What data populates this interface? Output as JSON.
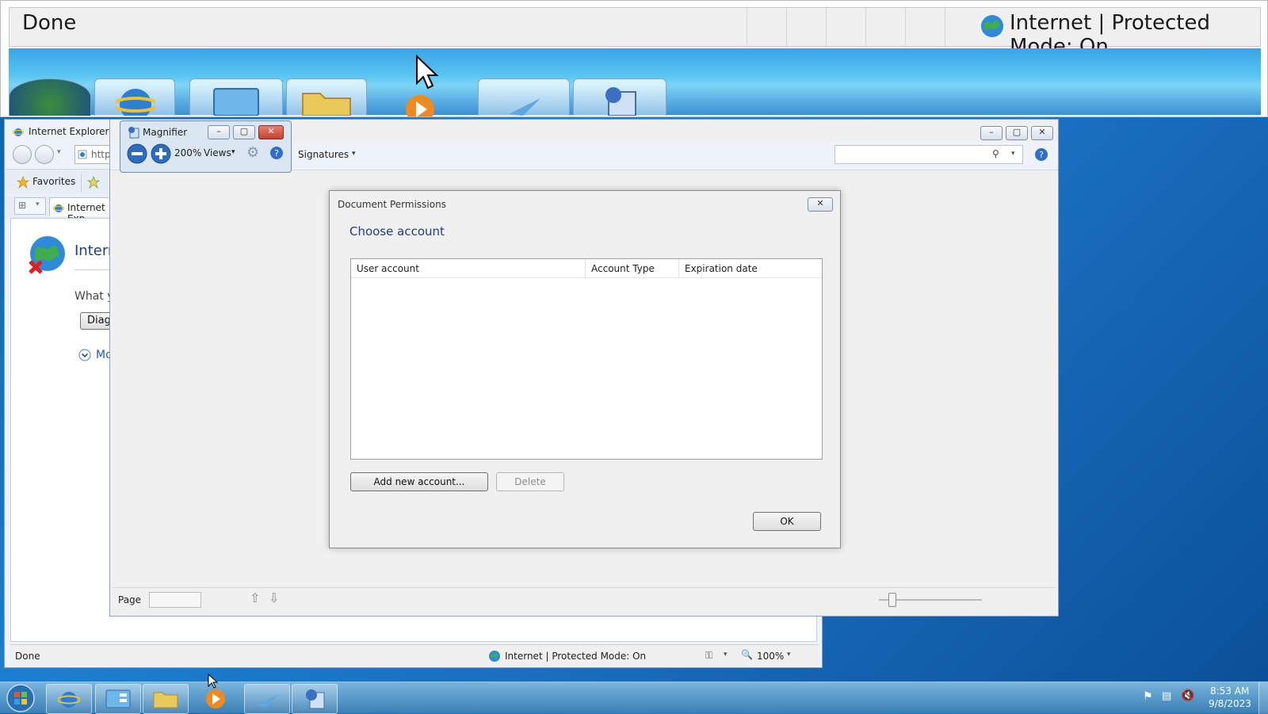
{
  "magnified": {
    "status_text": "Done",
    "zone_text": "Internet | Protected Mode: On"
  },
  "ie": {
    "title": "Internet Explorer car",
    "address": "http",
    "favorites": "Favorites",
    "tab_label": "Internet Exp",
    "heading": "Intern",
    "prompt": "What y",
    "diag_button": "Diag",
    "more_link": "Mo",
    "status_done": "Done",
    "status_zone": "Internet | Protected Mode: On",
    "zoom": "100%"
  },
  "magnifier": {
    "title": "Magnifier",
    "zoom": "200%",
    "views": "Views"
  },
  "acrobat": {
    "signatures": "Signatures",
    "page_label": "Page",
    "page_value": ""
  },
  "dialog": {
    "title": "Document Permissions",
    "heading": "Choose account",
    "columns": [
      "User account",
      "Account Type",
      "Expiration date"
    ],
    "rows": [],
    "add_button": "Add new account...",
    "delete_button": "Delete",
    "ok_button": "OK"
  },
  "taskbar": {
    "time": "8:53 AM",
    "date": "9/8/2023"
  },
  "colors": {
    "accent_blue": "#1e3e86",
    "taskbar_blue": "#5a9ccc",
    "close_red": "#c7402f"
  }
}
